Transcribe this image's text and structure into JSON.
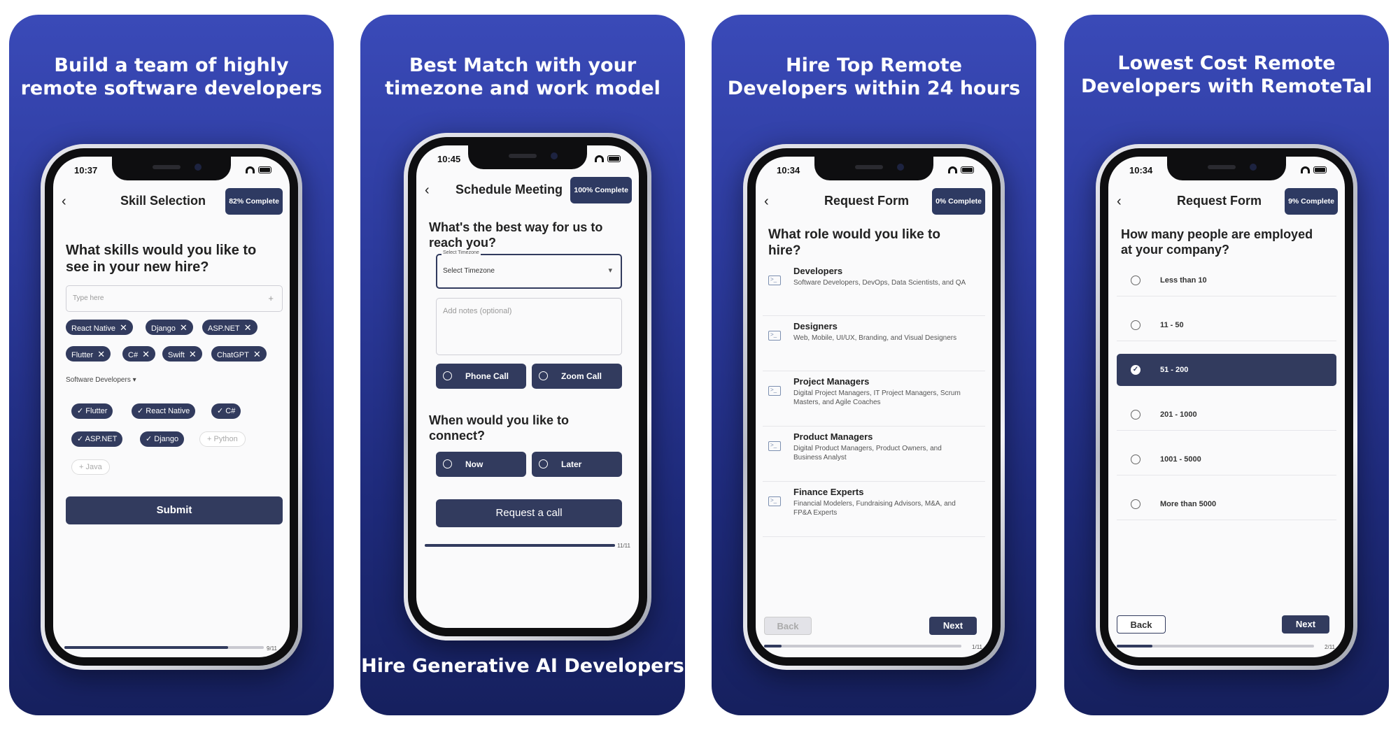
{
  "panels": [
    {
      "title": "Build a team of highly\nremote software developers",
      "phone": {
        "time": "10:37",
        "header": "Skill Selection",
        "badge": "82% Complete",
        "question": "What skills would you like to see in your new hire?",
        "input_placeholder": "Type here",
        "selected_skills": [
          "React Native",
          "Django",
          "ASP.NET",
          "Flutter",
          "C#",
          "Swift",
          "ChatGPT"
        ],
        "filter_label": "Software Developers",
        "suggested_checked": [
          "Flutter",
          "React Native",
          "C#",
          "ASP.NET",
          "Django"
        ],
        "suggested_unchecked": [
          "Python",
          "Java"
        ],
        "submit_label": "Submit",
        "progress": 0.82,
        "page": "9/11"
      }
    },
    {
      "title": "Best Match with your\ntimezone and work model",
      "caption": "Hire Generative AI Developers",
      "phone": {
        "time": "10:45",
        "header": "Schedule Meeting",
        "badge": "100% Complete",
        "question1": "What's the best way for us to reach you?",
        "timezone_label": "Select Timezone",
        "timezone_value": "Select Timezone",
        "notes_placeholder": "Add notes (optional)",
        "contact_options": [
          "Phone Call",
          "Zoom Call"
        ],
        "question2": "When would you like to connect?",
        "time_options": [
          "Now",
          "Later"
        ],
        "request_label": "Request a call",
        "progress": 1.0,
        "page": "11/11"
      }
    },
    {
      "title": "Hire Top Remote\nDevelopers within 24 hours",
      "phone": {
        "time": "10:34",
        "header": "Request Form",
        "badge": "0% Complete",
        "question": "What role would you like to hire?",
        "roles": [
          {
            "title": "Developers",
            "desc": "Software Developers, DevOps, Data Scientists, and QA"
          },
          {
            "title": "Designers",
            "desc": "Web, Mobile, UI/UX, Branding, and Visual Designers"
          },
          {
            "title": "Project Managers",
            "desc": "Digital Project Managers, IT Project Managers, Scrum Masters, and Agile Coaches"
          },
          {
            "title": "Product Managers",
            "desc": "Digital Product Managers, Product Owners, and Business Analyst"
          },
          {
            "title": "Finance Experts",
            "desc": "Financial Modelers, Fundraising Advisors, M&A, and FP&A Experts"
          }
        ],
        "back_label": "Back",
        "next_label": "Next",
        "progress": 0.09,
        "page": "1/11"
      }
    },
    {
      "title": "Lowest Cost Remote\nDevelopers with RemoteTal",
      "phone": {
        "time": "10:34",
        "header": "Request Form",
        "badge": "9% Complete",
        "question": "How many people are employed at your company?",
        "options": [
          "Less than 10",
          "11 - 50",
          "51 - 200",
          "201 - 1000",
          "1001 - 5000",
          "More than 5000"
        ],
        "selected_index": 2,
        "back_label": "Back",
        "next_label": "Next",
        "progress": 0.18,
        "page": "2/11"
      }
    }
  ],
  "colors": {
    "accent": "#323b5e",
    "card_top": "#3a4ab8",
    "card_bottom": "#16205e"
  }
}
